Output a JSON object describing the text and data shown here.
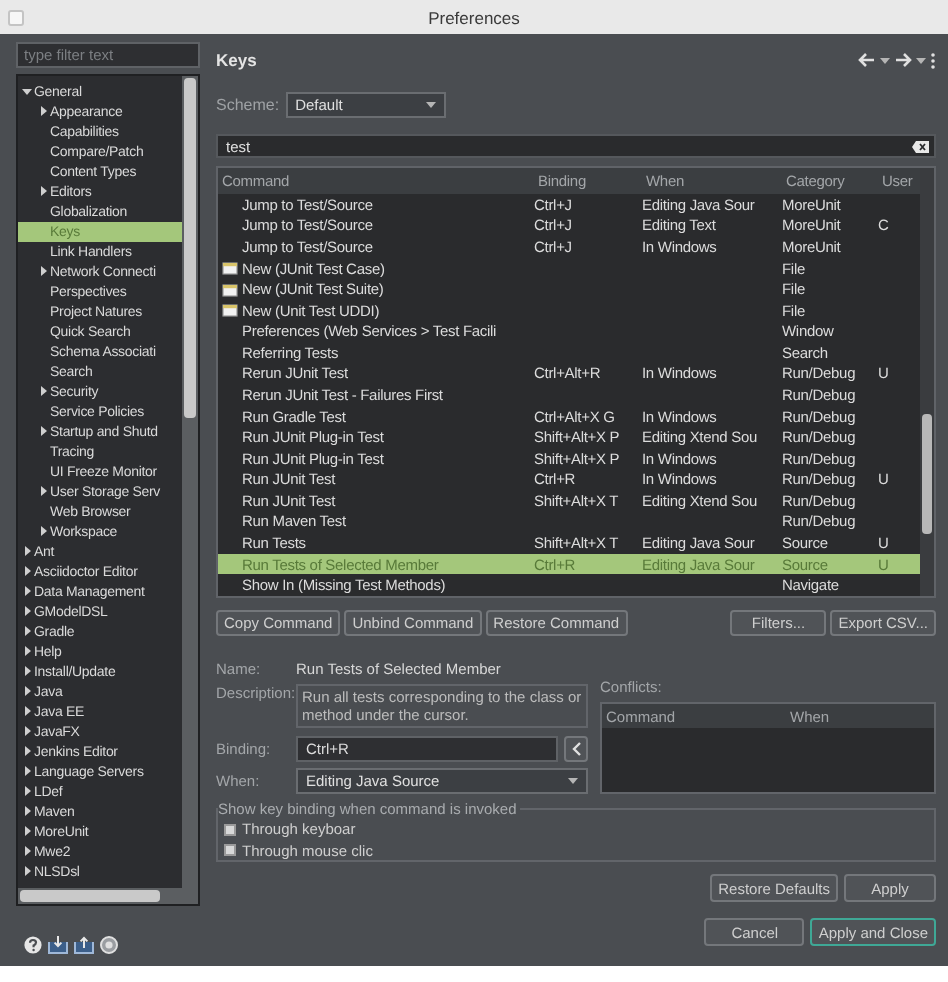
{
  "window": {
    "title": "Preferences"
  },
  "filter": {
    "placeholder": "type filter text"
  },
  "tree": [
    {
      "label": "General",
      "expanded": true,
      "selected": false,
      "children": [
        {
          "label": "Appearance",
          "expanded": false,
          "selected": false
        },
        {
          "label": "Capabilities",
          "selected": false
        },
        {
          "label": "Compare/Patch",
          "selected": false
        },
        {
          "label": "Content Types",
          "selected": false
        },
        {
          "label": "Editors",
          "expanded": false,
          "selected": false
        },
        {
          "label": "Globalization",
          "selected": false
        },
        {
          "label": "Keys",
          "selected": true
        },
        {
          "label": "Link Handlers",
          "selected": false
        },
        {
          "label": "Network Connecti",
          "expanded": false,
          "selected": false
        },
        {
          "label": "Perspectives",
          "selected": false
        },
        {
          "label": "Project Natures",
          "selected": false
        },
        {
          "label": "Quick Search",
          "selected": false
        },
        {
          "label": "Schema Associati",
          "selected": false
        },
        {
          "label": "Search",
          "selected": false
        },
        {
          "label": "Security",
          "expanded": false,
          "selected": false
        },
        {
          "label": "Service Policies",
          "selected": false
        },
        {
          "label": "Startup and Shutd",
          "expanded": false,
          "selected": false
        },
        {
          "label": "Tracing",
          "selected": false
        },
        {
          "label": "UI Freeze Monitor",
          "selected": false
        },
        {
          "label": "User Storage Serv",
          "expanded": false,
          "selected": false
        },
        {
          "label": "Web Browser",
          "selected": false
        },
        {
          "label": "Workspace",
          "expanded": false,
          "selected": false
        }
      ]
    },
    {
      "label": "Ant",
      "expanded": false,
      "selected": false
    },
    {
      "label": "Asciidoctor Editor",
      "expanded": false,
      "selected": false
    },
    {
      "label": "Data Management",
      "expanded": false,
      "selected": false
    },
    {
      "label": "GModelDSL",
      "expanded": false,
      "selected": false
    },
    {
      "label": "Gradle",
      "expanded": false,
      "selected": false
    },
    {
      "label": "Help",
      "expanded": false,
      "selected": false
    },
    {
      "label": "Install/Update",
      "expanded": false,
      "selected": false
    },
    {
      "label": "Java",
      "expanded": false,
      "selected": false
    },
    {
      "label": "Java EE",
      "expanded": false,
      "selected": false
    },
    {
      "label": "JavaFX",
      "expanded": false,
      "selected": false
    },
    {
      "label": "Jenkins Editor",
      "expanded": false,
      "selected": false
    },
    {
      "label": "Language Servers",
      "expanded": false,
      "selected": false
    },
    {
      "label": "LDef",
      "expanded": false,
      "selected": false
    },
    {
      "label": "Maven",
      "expanded": false,
      "selected": false
    },
    {
      "label": "MoreUnit",
      "expanded": false,
      "selected": false
    },
    {
      "label": "Mwe2",
      "expanded": false,
      "selected": false
    },
    {
      "label": "NLSDsl",
      "expanded": false,
      "selected": false
    }
  ],
  "page": {
    "title": "Keys"
  },
  "scheme": {
    "label": "Scheme:",
    "value": "Default"
  },
  "search": {
    "value": "test"
  },
  "table": {
    "columns": [
      "Command",
      "Binding",
      "When",
      "Category",
      "User"
    ],
    "rows": [
      {
        "kind": "command",
        "command": "Jump to Test/Source",
        "binding": "Ctrl+J",
        "when": "Editing Java Sour",
        "category": "MoreUnit",
        "user": "",
        "selected": false
      },
      {
        "kind": "command",
        "command": "Jump to Test/Source",
        "binding": "Ctrl+J",
        "when": "Editing Text",
        "category": "MoreUnit",
        "user": "C",
        "selected": false
      },
      {
        "kind": "command",
        "command": "Jump to Test/Source",
        "binding": "Ctrl+J",
        "when": "In Windows",
        "category": "MoreUnit",
        "user": "",
        "selected": false
      },
      {
        "kind": "wizard",
        "command": "New (JUnit Test Case)",
        "binding": "",
        "when": "",
        "category": "File",
        "user": "",
        "selected": false
      },
      {
        "kind": "wizard",
        "command": "New (JUnit Test Suite)",
        "binding": "",
        "when": "",
        "category": "File",
        "user": "",
        "selected": false
      },
      {
        "kind": "wizard",
        "command": "New (Unit Test UDDI)",
        "binding": "",
        "when": "",
        "category": "File",
        "user": "",
        "selected": false
      },
      {
        "kind": "command",
        "command": "Preferences (Web Services > Test Facili",
        "binding": "",
        "when": "",
        "category": "Window",
        "user": "",
        "selected": false
      },
      {
        "kind": "command",
        "command": "Referring Tests",
        "binding": "",
        "when": "",
        "category": "Search",
        "user": "",
        "selected": false
      },
      {
        "kind": "command",
        "command": "Rerun JUnit Test",
        "binding": "Ctrl+Alt+R",
        "when": "In Windows",
        "category": "Run/Debug",
        "user": "U",
        "selected": false
      },
      {
        "kind": "command",
        "command": "Rerun JUnit Test - Failures First",
        "binding": "",
        "when": "",
        "category": "Run/Debug",
        "user": "",
        "selected": false
      },
      {
        "kind": "command",
        "command": "Run Gradle Test",
        "binding": "Ctrl+Alt+X G",
        "when": "In Windows",
        "category": "Run/Debug",
        "user": "",
        "selected": false
      },
      {
        "kind": "command",
        "command": "Run JUnit Plug-in Test",
        "binding": "Shift+Alt+X P",
        "when": "Editing Xtend Sou",
        "category": "Run/Debug",
        "user": "",
        "selected": false
      },
      {
        "kind": "command",
        "command": "Run JUnit Plug-in Test",
        "binding": "Shift+Alt+X P",
        "when": "In Windows",
        "category": "Run/Debug",
        "user": "",
        "selected": false
      },
      {
        "kind": "command",
        "command": "Run JUnit Test",
        "binding": "Ctrl+R",
        "when": "In Windows",
        "category": "Run/Debug",
        "user": "U",
        "selected": false
      },
      {
        "kind": "command",
        "command": "Run JUnit Test",
        "binding": "Shift+Alt+X T",
        "when": "Editing Xtend Sou",
        "category": "Run/Debug",
        "user": "",
        "selected": false
      },
      {
        "kind": "command",
        "command": "Run Maven Test",
        "binding": "",
        "when": "",
        "category": "Run/Debug",
        "user": "",
        "selected": false
      },
      {
        "kind": "command",
        "command": "Run Tests",
        "binding": "Shift+Alt+X T",
        "when": "Editing Java Sour",
        "category": "Source",
        "user": "U",
        "selected": false
      },
      {
        "kind": "command",
        "command": "Run Tests of Selected Member",
        "binding": "Ctrl+R",
        "when": "Editing Java Sour",
        "category": "Source",
        "user": "U",
        "selected": true
      },
      {
        "kind": "command",
        "command": "Show In (Missing Test Methods)",
        "binding": "",
        "when": "",
        "category": "Navigate",
        "user": "",
        "selected": false
      }
    ]
  },
  "table_buttons": [
    "Copy Command",
    "Unbind Command",
    "Restore Command"
  ],
  "side_buttons": [
    "Filters...",
    "Export CSV..."
  ],
  "details": {
    "name_label": "Name:",
    "name": "Run Tests of Selected Member",
    "description_label": "Description:",
    "description": "Run all tests corresponding to the class or method under the cursor.",
    "binding_label": "Binding:",
    "binding": "Ctrl+R",
    "when_label": "When:",
    "when": "Editing Java Source"
  },
  "conflicts": {
    "label": "Conflicts:",
    "columns": [
      "Command",
      "When"
    ]
  },
  "show_binding": {
    "title": "Show key binding when command is invoked",
    "options": [
      {
        "label": "Through keyboar",
        "checked": false
      },
      {
        "label": "Through mouse clic",
        "checked": false
      }
    ]
  },
  "page_buttons": [
    "Restore Defaults",
    "Apply"
  ],
  "dialog_buttons": [
    {
      "label": "Cancel",
      "default": false
    },
    {
      "label": "Apply and Close",
      "default": true
    }
  ]
}
